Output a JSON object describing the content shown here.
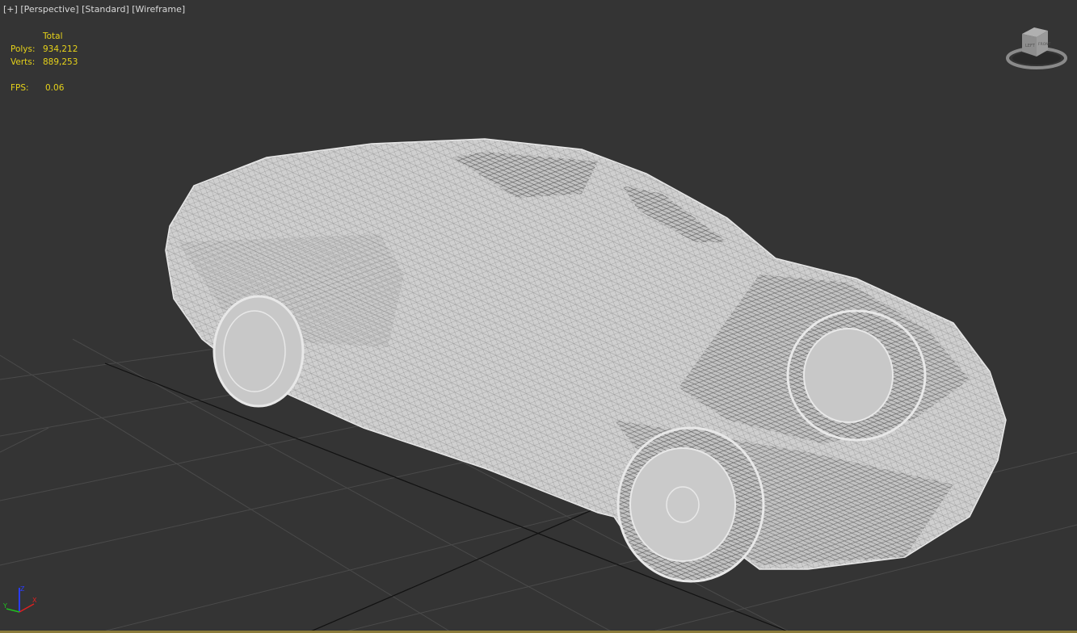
{
  "viewport": {
    "menu_plus": "[+]",
    "view_label": "[Perspective]",
    "shading_label": "[Standard]",
    "display_label": "[Wireframe]"
  },
  "stats": {
    "header": "Total",
    "polys_label": "Polys:",
    "polys_value": "934,212",
    "verts_label": "Verts:",
    "verts_value": "889,253",
    "fps_label": "FPS:",
    "fps_value": "0.06"
  },
  "viewcube": {
    "faces": [
      "LEFT",
      "FRONT"
    ]
  },
  "axis_gizmo": {
    "x": "X",
    "y": "Y",
    "z": "Z"
  },
  "colors": {
    "background": "#343434",
    "stats_text": "#e6d21a",
    "wire": "#d6d6d6"
  }
}
